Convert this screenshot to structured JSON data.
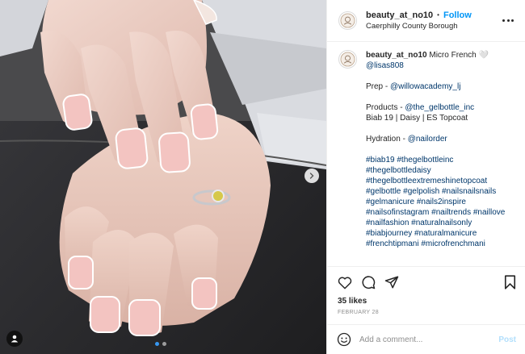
{
  "post": {
    "username": "beauty_at_no10",
    "separator": "•",
    "follow_label": "Follow",
    "location": "Caerphilly County Borough",
    "more_icon": "more-horizontal-icon"
  },
  "caption": {
    "username": "beauty_at_no10",
    "title": "Micro French 🤍",
    "mention": "@lisas808",
    "prep_label": "Prep - ",
    "prep_link": "@willowacademy_lj",
    "products_label": "Products - ",
    "products_link": "@the_gelbottle_inc",
    "products_detail": "Biab 19 | Daisy | ES Topcoat",
    "hydration_label": "Hydration - ",
    "hydration_link": "@nailorder",
    "hashtags": [
      "#biab19",
      "#thegelbottleinc",
      "#thegelbottledaisy",
      "#thegelbottleextremeshinetopcoat",
      "#gelbottle",
      "#gelpolish",
      "#nailsnailsnails",
      "#gelmanicure",
      "#nails2inspire",
      "#nailsofinstagram",
      "#nailtrends",
      "#naillove",
      "#nailfashion",
      "#naturalnailsonly",
      "#biabjourney",
      "#naturalmanicure",
      "#frenchtipmani",
      "#microfrenchmani"
    ]
  },
  "actions": {
    "like_icon": "heart-icon",
    "comment_icon": "comment-icon",
    "share_icon": "share-icon",
    "save_icon": "bookmark-icon",
    "likes": "35 likes",
    "date": "FEBRUARY 28"
  },
  "comment": {
    "emoji_icon": "smiley-icon",
    "placeholder": "Add a comment...",
    "post_label": "Post"
  },
  "carousel": {
    "slide_count": 2,
    "active_index": 0
  },
  "colors": {
    "link": "#00376b",
    "follow": "#0095f6",
    "post_disabled": "#b2dffc",
    "nail_pink": "#f3c4c1",
    "background_leather": "#2a2a2c"
  }
}
